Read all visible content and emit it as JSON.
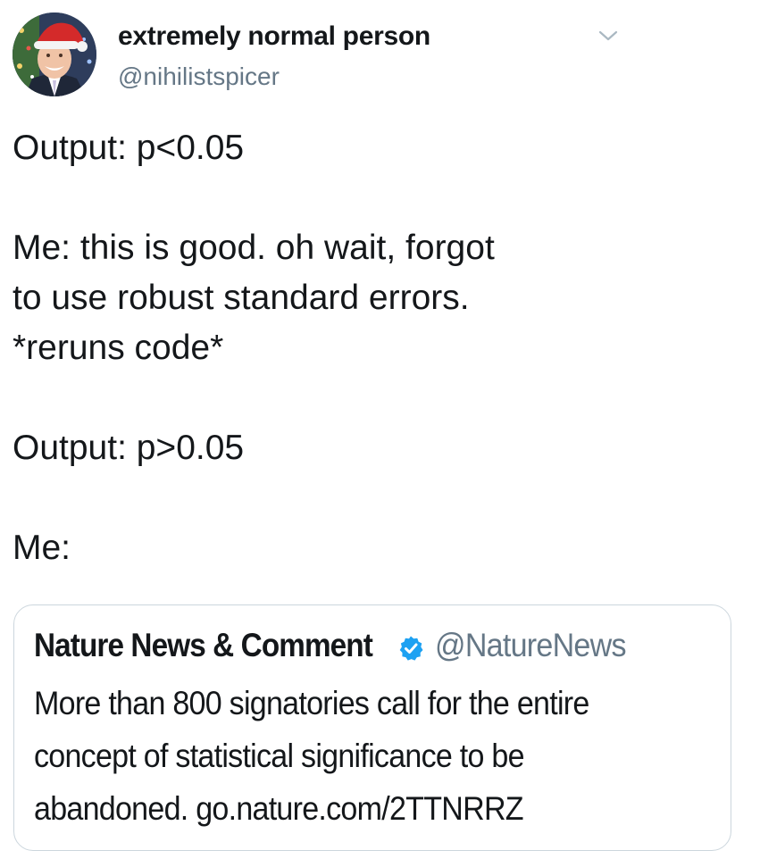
{
  "tweet": {
    "author": {
      "display_name": "extremely normal person",
      "handle": "@nihilistspicer",
      "avatar_icon": "avatar-santa-hat"
    },
    "menu_icon": "chevron-down-icon",
    "text_lines": [
      "Output: p<0.05",
      "",
      "Me: this is good. oh wait, forgot",
      "to use robust standard errors.",
      "*reruns code*",
      "",
      "Output: p>0.05",
      "",
      "Me:"
    ]
  },
  "quoted_tweet": {
    "author_name": "Nature News & Comment",
    "verified": true,
    "verified_icon": "verified-badge-icon",
    "handle": "@NatureNews",
    "text_lines": [
      "More than 800 signatories call for the entire",
      "concept of statistical significance to be",
      "abandoned. go.nature.com/2TTNRRZ"
    ]
  },
  "colors": {
    "text_primary": "#14171a",
    "text_secondary": "#657786",
    "border": "#ccd6dd",
    "verified_blue": "#1da1f2"
  }
}
